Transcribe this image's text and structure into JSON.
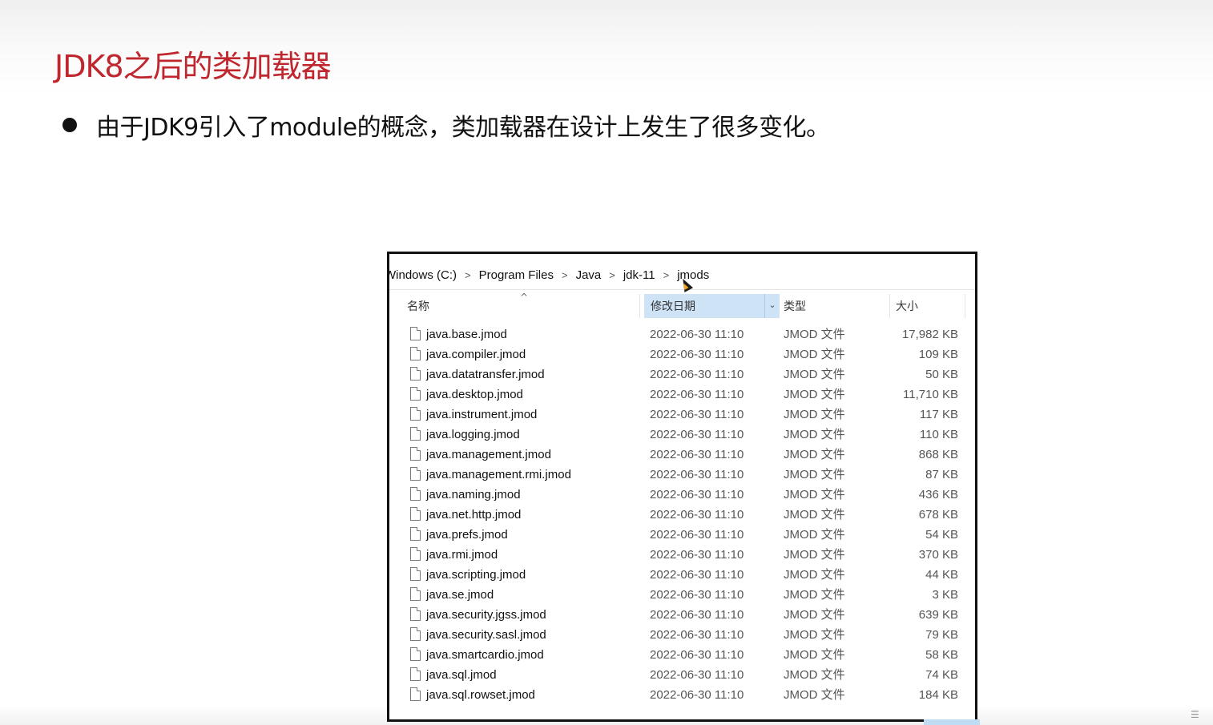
{
  "slide": {
    "title": "JDK8之后的类加载器",
    "bullet": "由于JDK9引入了module的概念，类加载器在设计上发生了很多变化。"
  },
  "explorer": {
    "breadcrumb": [
      "Windows (C:)",
      "Program Files",
      "Java",
      "jdk-11",
      "jmods"
    ],
    "breadcrumb_separator": ">",
    "columns": {
      "name": "名称",
      "date": "修改日期",
      "type": "类型",
      "size": "大小"
    },
    "sort_indicator": "^",
    "dropdown_indicator": "⌄",
    "files": [
      {
        "name": "java.base.jmod",
        "date": "2022-06-30 11:10",
        "type": "JMOD 文件",
        "size": "17,982 KB"
      },
      {
        "name": "java.compiler.jmod",
        "date": "2022-06-30 11:10",
        "type": "JMOD 文件",
        "size": "109 KB"
      },
      {
        "name": "java.datatransfer.jmod",
        "date": "2022-06-30 11:10",
        "type": "JMOD 文件",
        "size": "50 KB"
      },
      {
        "name": "java.desktop.jmod",
        "date": "2022-06-30 11:10",
        "type": "JMOD 文件",
        "size": "11,710 KB"
      },
      {
        "name": "java.instrument.jmod",
        "date": "2022-06-30 11:10",
        "type": "JMOD 文件",
        "size": "117 KB"
      },
      {
        "name": "java.logging.jmod",
        "date": "2022-06-30 11:10",
        "type": "JMOD 文件",
        "size": "110 KB"
      },
      {
        "name": "java.management.jmod",
        "date": "2022-06-30 11:10",
        "type": "JMOD 文件",
        "size": "868 KB"
      },
      {
        "name": "java.management.rmi.jmod",
        "date": "2022-06-30 11:10",
        "type": "JMOD 文件",
        "size": "87 KB"
      },
      {
        "name": "java.naming.jmod",
        "date": "2022-06-30 11:10",
        "type": "JMOD 文件",
        "size": "436 KB"
      },
      {
        "name": "java.net.http.jmod",
        "date": "2022-06-30 11:10",
        "type": "JMOD 文件",
        "size": "678 KB"
      },
      {
        "name": "java.prefs.jmod",
        "date": "2022-06-30 11:10",
        "type": "JMOD 文件",
        "size": "54 KB"
      },
      {
        "name": "java.rmi.jmod",
        "date": "2022-06-30 11:10",
        "type": "JMOD 文件",
        "size": "370 KB"
      },
      {
        "name": "java.scripting.jmod",
        "date": "2022-06-30 11:10",
        "type": "JMOD 文件",
        "size": "44 KB"
      },
      {
        "name": "java.se.jmod",
        "date": "2022-06-30 11:10",
        "type": "JMOD 文件",
        "size": "3 KB"
      },
      {
        "name": "java.security.jgss.jmod",
        "date": "2022-06-30 11:10",
        "type": "JMOD 文件",
        "size": "639 KB"
      },
      {
        "name": "java.security.sasl.jmod",
        "date": "2022-06-30 11:10",
        "type": "JMOD 文件",
        "size": "79 KB"
      },
      {
        "name": "java.smartcardio.jmod",
        "date": "2022-06-30 11:10",
        "type": "JMOD 文件",
        "size": "58 KB"
      },
      {
        "name": "java.sql.jmod",
        "date": "2022-06-30 11:10",
        "type": "JMOD 文件",
        "size": "74 KB"
      },
      {
        "name": "java.sql.rowset.jmod",
        "date": "2022-06-30 11:10",
        "type": "JMOD 文件",
        "size": "184 KB"
      }
    ]
  },
  "colors": {
    "title": "#c0262d",
    "header_highlight": "#cfe3f7",
    "frame": "#111111"
  },
  "icons": {
    "file": "file-icon",
    "cursor": "mouse-cursor-icon",
    "bullet": "bullet-dot"
  }
}
